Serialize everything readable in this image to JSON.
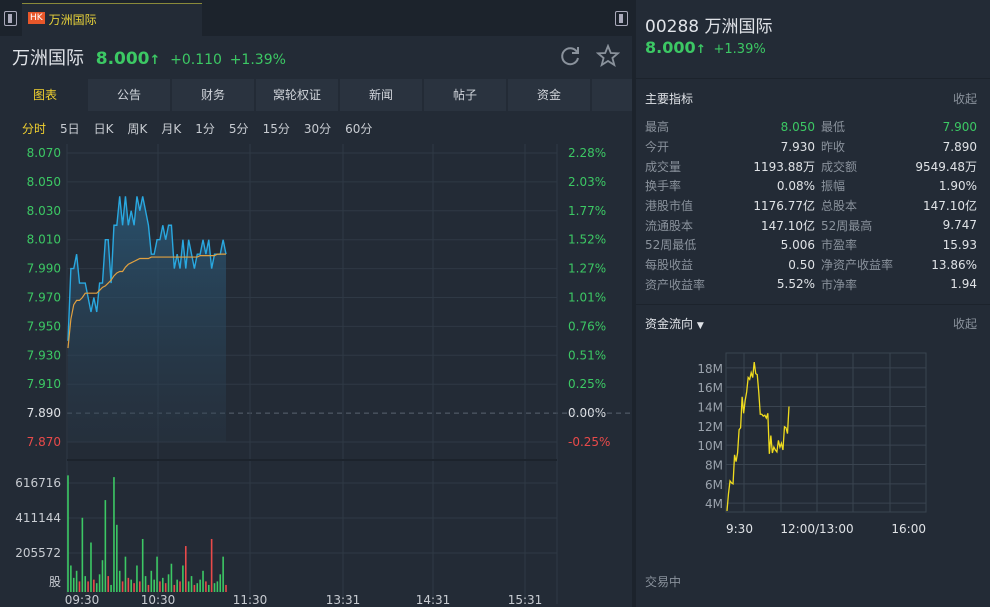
{
  "tab": {
    "badge": "HK",
    "name": "万洲国际"
  },
  "header": {
    "name": "万洲国际",
    "price": "8.000",
    "arrow": "↑",
    "change": "+0.110",
    "pct": "+1.39%"
  },
  "subtabs": [
    "图表",
    "公告",
    "财务",
    "窝轮权证",
    "新闻",
    "帖子",
    "资金"
  ],
  "periods": [
    "分时",
    "5日",
    "日K",
    "周K",
    "月K",
    "1分",
    "5分",
    "15分",
    "30分",
    "60分"
  ],
  "chart_data": [
    {
      "type": "line",
      "title": "分时",
      "ylim": [
        7.87,
        8.07
      ],
      "y_ticks_left": [
        "8.070",
        "8.050",
        "8.030",
        "8.010",
        "7.990",
        "7.970",
        "7.950",
        "7.930",
        "7.910",
        "7.890",
        "7.870"
      ],
      "y_ticks_right": [
        "2.28%",
        "2.03%",
        "1.77%",
        "1.52%",
        "1.27%",
        "1.01%",
        "0.76%",
        "0.51%",
        "0.25%",
        "0.00%",
        "-0.25%"
      ],
      "prev_close": 7.89,
      "x_ticks": [
        "09:30",
        "10:30",
        "11:30",
        "13:31",
        "14:31",
        "15:31"
      ],
      "series": [
        {
          "name": "price",
          "color": "#29a8e0",
          "values": [
            7.94,
            7.99,
            7.99,
            8.0,
            7.98,
            7.98,
            7.98,
            7.97,
            7.96,
            7.97,
            7.96,
            7.98,
            7.98,
            8.01,
            8.01,
            7.98,
            8.02,
            8.02,
            8.04,
            8.02,
            8.04,
            8.02,
            8.03,
            8.02,
            8.04,
            8.03,
            8.04,
            8.03,
            8.02,
            8.0,
            8.0,
            8.01,
            8.01,
            8.02,
            8.01,
            8.02,
            8.02,
            7.99,
            8.0,
            7.99,
            8.01,
            7.99,
            8.01,
            8.0,
            7.99,
            8.0,
            8.0,
            8.01,
            8.0,
            8.01,
            7.99,
            8.0,
            8.0,
            8.0,
            8.01,
            8.0
          ]
        },
        {
          "name": "average",
          "color": "#e0a040",
          "values": [
            7.935,
            7.955,
            7.965,
            7.968,
            7.968,
            7.97,
            7.973,
            7.973,
            7.973,
            7.973,
            7.973,
            7.975,
            7.977,
            7.978,
            7.98,
            7.982,
            7.985,
            7.987,
            7.988,
            7.988,
            7.991,
            7.993,
            7.994,
            7.995,
            7.996,
            7.997,
            7.997,
            7.997,
            7.997,
            7.998,
            7.998,
            7.998,
            7.998,
            7.998,
            7.998,
            7.998,
            7.998,
            7.998,
            7.998,
            7.998,
            7.998,
            7.998,
            7.998,
            7.998,
            7.998,
            7.998,
            7.999,
            7.999,
            7.999,
            7.999,
            7.999,
            7.999,
            8.0,
            8.0,
            8.0,
            8.0
          ]
        }
      ],
      "volume": {
        "ticks": [
          "616716",
          "411144",
          "205572",
          "股"
        ],
        "max": 616716,
        "values": [
          660000,
          150000,
          80000,
          120000,
          60000,
          420000,
          90000,
          60000,
          280000,
          70000,
          50000,
          100000,
          180000,
          520000,
          90000,
          40000,
          650000,
          380000,
          120000,
          60000,
          200000,
          80000,
          70000,
          50000,
          150000,
          60000,
          300000,
          90000,
          40000,
          120000,
          70000,
          200000,
          60000,
          80000,
          50000,
          100000,
          160000,
          40000,
          70000,
          60000,
          150000,
          260000,
          60000,
          90000,
          40000,
          50000,
          70000,
          120000,
          60000,
          40000,
          300000,
          50000,
          60000,
          100000,
          200000,
          40000
        ],
        "up": [
          1,
          1,
          1,
          1,
          0,
          1,
          1,
          0,
          1,
          0,
          1,
          1,
          1,
          1,
          0,
          1,
          1,
          1,
          1,
          0,
          1,
          0,
          1,
          0,
          1,
          0,
          1,
          1,
          0,
          1,
          1,
          1,
          0,
          1,
          0,
          1,
          1,
          0,
          1,
          0,
          1,
          0,
          1,
          1,
          0,
          1,
          1,
          1,
          0,
          1,
          0,
          1,
          1,
          1,
          1,
          0
        ]
      }
    },
    {
      "type": "line",
      "title": "资金流向",
      "ylim": [
        3,
        18.8
      ],
      "y_ticks": [
        "18M",
        "16M",
        "14M",
        "12M",
        "10M",
        "8M",
        "6M",
        "4M"
      ],
      "x_ticks": [
        "9:30",
        "12:00/13:00",
        "16:00"
      ],
      "series": [
        {
          "name": "资金流向",
          "color": "#f0dc1e",
          "values": [
            3.2,
            5.0,
            6.3,
            6.1,
            6.0,
            9.0,
            8.3,
            9.2,
            11.6,
            11.8,
            15.0,
            13.3,
            14.6,
            15.5,
            17.0,
            16.8,
            17.5,
            17.0,
            18.6,
            17.4,
            17.3,
            15.5,
            13.2,
            13.2,
            13.0,
            13.1,
            12.8,
            13.3,
            9.1,
            11.0,
            9.2,
            9.8,
            9.5,
            9.3,
            10.5,
            9.8,
            10.2,
            9.5,
            11.9,
            11.8,
            11.2,
            14.0
          ]
        }
      ]
    }
  ],
  "indicators": {
    "title": "主要指标",
    "fold": "收起",
    "rows": [
      [
        "最高",
        "8.050",
        "最低",
        "7.900"
      ],
      [
        "今开",
        "7.930",
        "昨收",
        "7.890"
      ],
      [
        "成交量",
        "1193.88万",
        "成交额",
        "9549.48万"
      ],
      [
        "换手率",
        "0.08%",
        "振幅",
        "1.90%"
      ],
      [
        "港股市值",
        "1176.77亿",
        "总股本",
        "147.10亿"
      ],
      [
        "流通股本",
        "147.10亿",
        "52周最高",
        "9.747"
      ],
      [
        "52周最低",
        "5.006",
        "市盈率",
        "15.93"
      ],
      [
        "每股收益",
        "0.50",
        "净资产收益率",
        "13.86%"
      ],
      [
        "资产收益率",
        "5.52%",
        "市净率",
        "1.94"
      ]
    ]
  },
  "flow": {
    "title": "资金流向",
    "fold": "收起",
    "status": "交易中"
  },
  "right_header": {
    "code": "00288",
    "name": "万洲国际",
    "price": "8.000",
    "arrow": "↑",
    "pct": "+1.39%"
  },
  "colors": {
    "up": "#3cc864",
    "down": "#e84a4a",
    "accent": "#f0d030"
  }
}
